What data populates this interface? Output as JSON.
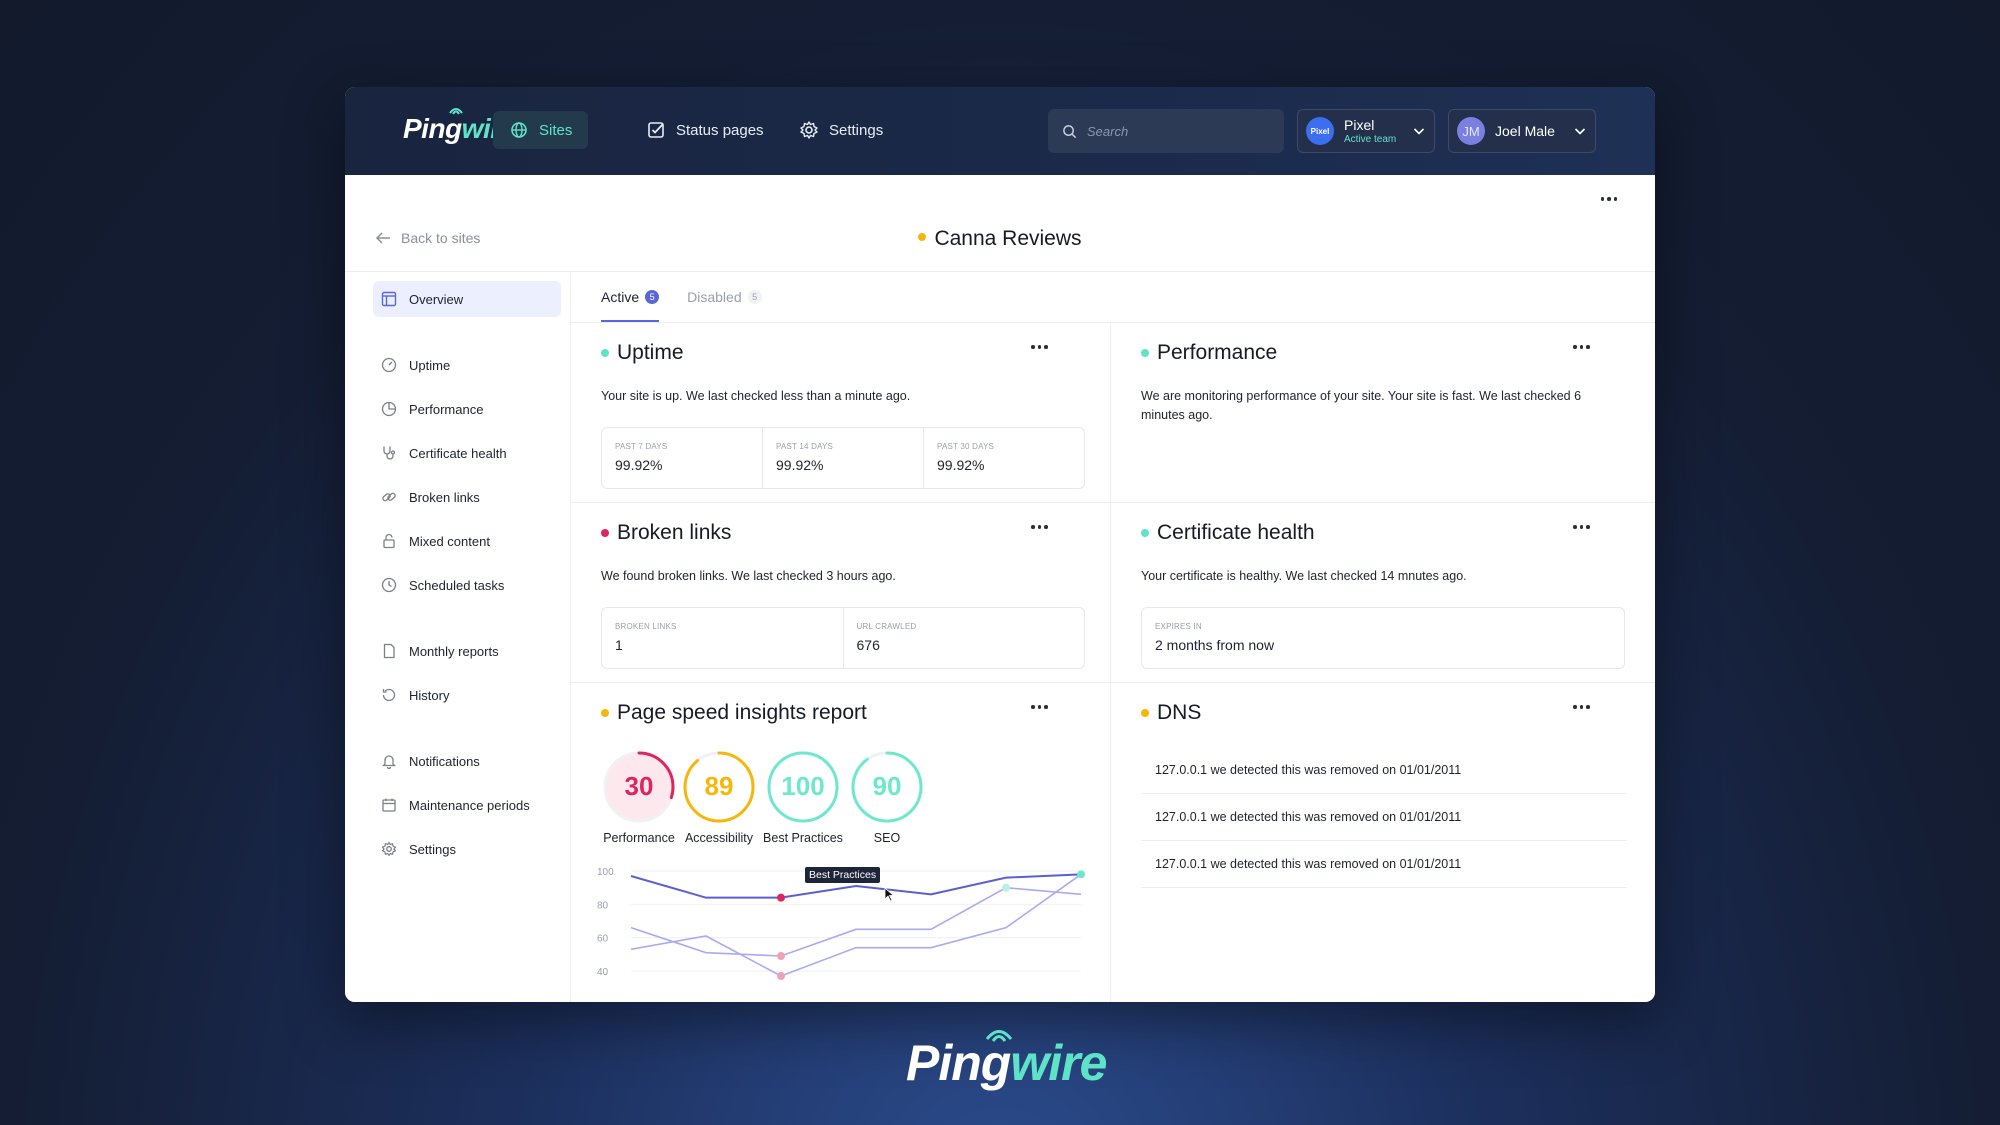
{
  "app": {
    "logo_part1": "Ping",
    "logo_part2": "wire"
  },
  "nav": {
    "sites": "Sites",
    "status_pages": "Status pages",
    "settings": "Settings"
  },
  "search": {
    "placeholder": "Search"
  },
  "team": {
    "avatar_text": "Pixel",
    "name": "Pixel",
    "sub": "Active team"
  },
  "user": {
    "initials": "JM",
    "name": "Joel Male"
  },
  "page": {
    "back_label": "Back to sites",
    "title": "Canna Reviews",
    "status_color": "#f5b70b"
  },
  "sidebar": {
    "items": [
      {
        "label": "Overview",
        "icon": "layout-icon"
      },
      {
        "label": "Uptime",
        "icon": "gauge-icon"
      },
      {
        "label": "Performance",
        "icon": "pie-icon"
      },
      {
        "label": "Certificate health",
        "icon": "stethoscope-icon"
      },
      {
        "label": "Broken links",
        "icon": "link-icon"
      },
      {
        "label": "Mixed content",
        "icon": "lock-icon"
      },
      {
        "label": "Scheduled tasks",
        "icon": "clock-icon"
      },
      {
        "label": "Monthly reports",
        "icon": "file-icon"
      },
      {
        "label": "History",
        "icon": "history-icon"
      },
      {
        "label": "Notifications",
        "icon": "bell-icon"
      },
      {
        "label": "Maintenance periods",
        "icon": "calendar-icon"
      },
      {
        "label": "Settings",
        "icon": "gear-icon"
      }
    ]
  },
  "tabs": {
    "active": {
      "label": "Active",
      "count": "5"
    },
    "disabled": {
      "label": "Disabled",
      "count": "5"
    }
  },
  "uptime": {
    "title": "Uptime",
    "status_color": "#5fe3c8",
    "desc": "Your site is up. We last checked less than a minute ago.",
    "stats": [
      {
        "label": "PAST 7 DAYS",
        "value": "99.92%"
      },
      {
        "label": "PAST 14 DAYS",
        "value": "99.92%"
      },
      {
        "label": "PAST 30 DAYS",
        "value": "99.92%"
      }
    ]
  },
  "performance": {
    "title": "Performance",
    "status_color": "#5fe3c8",
    "desc": "We are monitoring performance of your site. Your site is fast. We last checked 6 minutes ago."
  },
  "broken_links": {
    "title": "Broken links",
    "status_color": "#e0245e",
    "desc": "We found broken links. We last checked 3 hours ago.",
    "stats": [
      {
        "label": "BROKEN LINKS",
        "value": "1"
      },
      {
        "label": "URL CRAWLED",
        "value": "676"
      }
    ]
  },
  "certificate": {
    "title": "Certificate health",
    "status_color": "#5fe3c8",
    "desc": "Your certificate is healthy. We last checked 14 mnutes ago.",
    "stats": [
      {
        "label": "EXPIRES IN",
        "value": "2 months from now"
      }
    ]
  },
  "pagespeed": {
    "title": "Page speed insights report",
    "status_color": "#f5b70b",
    "tooltip": "Best Practices",
    "scores": [
      {
        "label": "Performance",
        "value": 30,
        "color": "#e0245e",
        "bg": "#fde8ee"
      },
      {
        "label": "Accessibility",
        "value": 89,
        "color": "#f5b70b",
        "bg": "#ffffff"
      },
      {
        "label": "Best Practices",
        "value": 100,
        "color": "#6ee7cf",
        "bg": "#ffffff"
      },
      {
        "label": "SEO",
        "value": 90,
        "color": "#6ee7cf",
        "bg": "#ffffff"
      }
    ]
  },
  "dns": {
    "title": "DNS",
    "status_color": "#f5b70b",
    "rows": [
      "127.0.0.1 we detected this was removed on 01/01/2011",
      "127.0.0.1 we detected this was removed on 01/01/2011",
      "127.0.0.1 we detected this was removed on 01/01/2011"
    ]
  },
  "chart_data": {
    "type": "line",
    "y_ticks": [
      "100",
      "80",
      "60",
      "40"
    ],
    "ylim": [
      40,
      100
    ],
    "series": [
      {
        "values": [
          97,
          84,
          84,
          91,
          86,
          96,
          98
        ],
        "color": "#5a5fcf"
      },
      {
        "values": [
          66,
          51,
          49,
          65,
          65,
          90,
          86
        ],
        "color": "#a9aaf0"
      },
      {
        "values": [
          53,
          61,
          37,
          54,
          54,
          66,
          98
        ],
        "color": "#a9aaf0"
      }
    ],
    "markers": [
      {
        "series": 0,
        "index": 2,
        "color": "#e0245e"
      },
      {
        "series": 1,
        "index": 2,
        "color": "#f2a0b8"
      },
      {
        "series": 2,
        "index": 2,
        "color": "#f2a0b8"
      },
      {
        "series": 0,
        "index": 6,
        "color": "#6ee7cf"
      },
      {
        "series": 1,
        "index": 5,
        "color": "#b6f2e4"
      }
    ]
  },
  "footer": {
    "logo_part1": "Ping",
    "logo_part2": "wire"
  }
}
